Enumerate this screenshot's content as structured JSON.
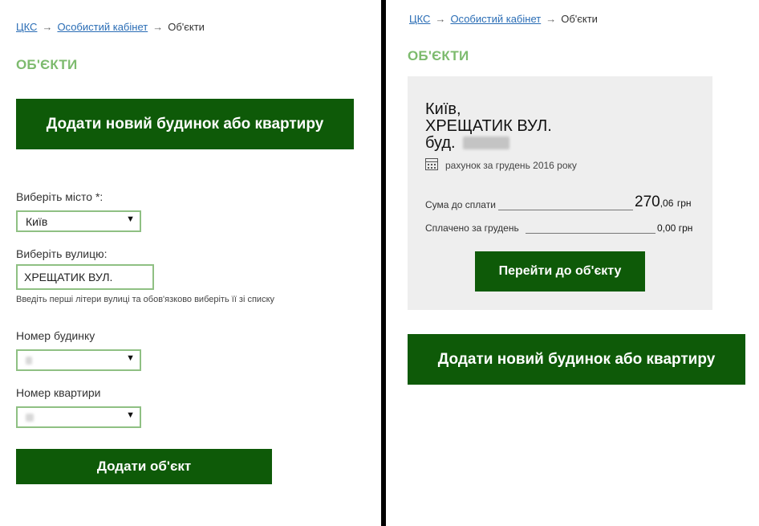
{
  "left": {
    "breadcrumb": {
      "home": "ЦКС",
      "cabinet": "Особистий кабінет",
      "current": "Об'єкти",
      "arrow": "→"
    },
    "title": "ОБ'ЄКТИ",
    "add_button": "Додати новий будинок або квартиру",
    "form": {
      "city_label": "Виберіть місто *:",
      "city_value": "Київ",
      "street_label": "Виберіть вулицю:",
      "street_value": "ХРЕЩАТИК ВУЛ.",
      "street_hint": "Введіть перші літери вулиці та обов'язково виберіть її зі списку",
      "house_label": "Номер будинку",
      "flat_label": "Номер квартири",
      "submit": "Додати об'єкт",
      "caret": "▼"
    }
  },
  "right": {
    "breadcrumb": {
      "home": "ЦКС",
      "cabinet": "Особистий кабінет",
      "current": "Об'єкти",
      "arrow": "→"
    },
    "title": "ОБ'ЄКТИ",
    "card": {
      "city": "Київ,",
      "street": "ХРЕЩАТИК ВУЛ.",
      "building_prefix": "буд.",
      "invoice": "рахунок за грудень 2016 року",
      "due_label": "Сума до сплати",
      "due_int": "270",
      "due_frac": ",06",
      "currency": "грн",
      "paid_label": "Сплачено за грудень",
      "paid_value": "0,00",
      "go_button": "Перейти до об'єкту"
    },
    "add_button": "Додати новий будинок або квартиру"
  },
  "colors": {
    "accent_green": "#0e5a08",
    "title_green": "#7dbb6e",
    "link_blue": "#2a6db5",
    "border_green": "#8fc083"
  }
}
